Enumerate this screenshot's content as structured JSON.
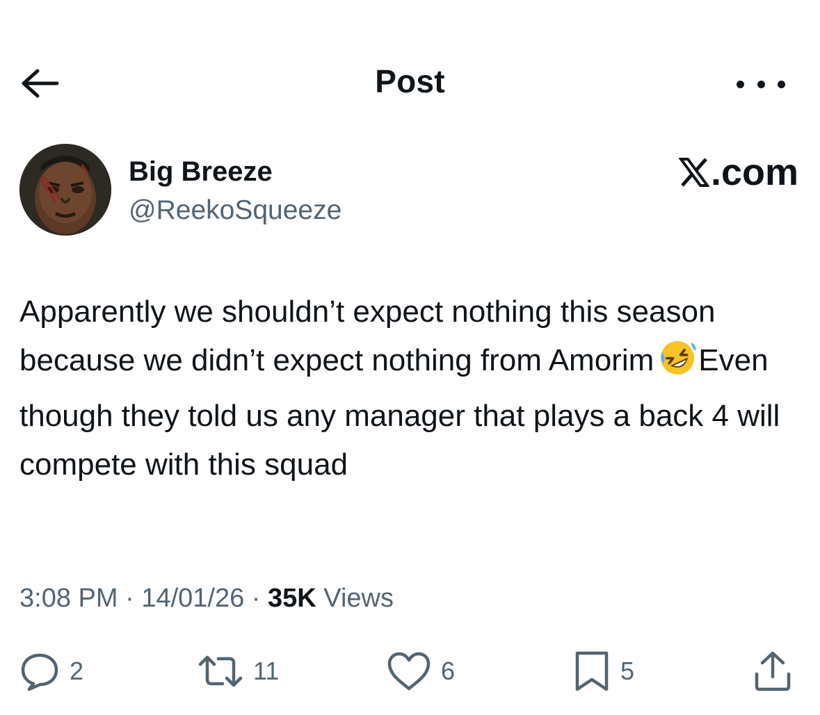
{
  "header": {
    "title": "Post"
  },
  "author": {
    "name": "Big Breeze",
    "handle": "@ReekoSqueeze"
  },
  "watermark": {
    "text": ".com"
  },
  "tweet": {
    "text_before_emoji": "Apparently we shouldn’t expect nothing this season because we didn’t expect nothing from Amorim",
    "emoji": "rolling-on-floor-laughing",
    "text_after_emoji": "Even though they told us any manager that plays a back 4 will compete with this squad"
  },
  "meta": {
    "time": "3:08 PM",
    "separator": "·",
    "date": "14/01/26",
    "views_count": "35K",
    "views_label": "Views"
  },
  "actions": {
    "replies": "2",
    "reposts": "11",
    "likes": "6",
    "bookmarks": "5"
  },
  "icons": {
    "back": "arrow-left-icon",
    "more": "more-dots-icon",
    "reply": "reply-icon",
    "repost": "repost-icon",
    "like": "heart-icon",
    "bookmark": "bookmark-icon",
    "share": "share-icon"
  },
  "colors": {
    "text": "#0f1419",
    "secondary": "#536471",
    "background": "#ffffff"
  }
}
